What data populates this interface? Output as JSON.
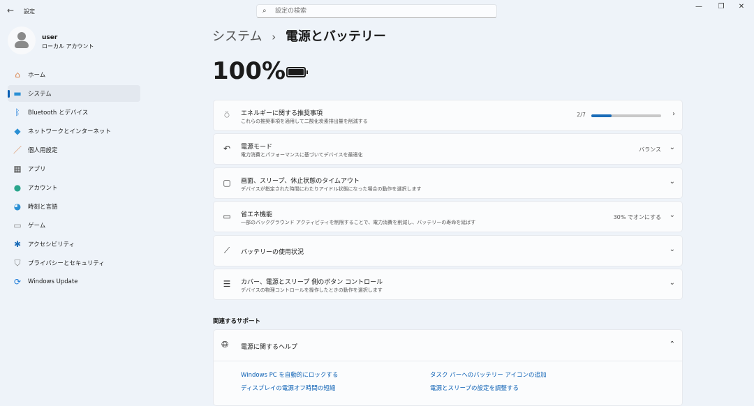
{
  "app": {
    "title": "設定",
    "back": "←"
  },
  "search": {
    "placeholder": "設定の検索"
  },
  "window": {
    "minimize": "—",
    "maximize": "❐",
    "close": "✕"
  },
  "user": {
    "name": "user",
    "type": "ローカル アカウント"
  },
  "sidebar": {
    "items": [
      {
        "label": "ホーム",
        "icon": "home-icon",
        "glyph": "⌂",
        "color": "#d9824a"
      },
      {
        "label": "システム",
        "icon": "system-icon",
        "glyph": "▬",
        "color": "#2a8fd4"
      },
      {
        "label": "Bluetooth とデバイス",
        "icon": "bluetooth-icon",
        "glyph": "ᛒ",
        "color": "#1a7ad8"
      },
      {
        "label": "ネットワークとインターネット",
        "icon": "wifi-icon",
        "glyph": "◆",
        "color": "#2a8fd4"
      },
      {
        "label": "個人用設定",
        "icon": "brush-icon",
        "glyph": "／",
        "color": "#d9824a"
      },
      {
        "label": "アプリ",
        "icon": "apps-icon",
        "glyph": "▦",
        "color": "#555"
      },
      {
        "label": "アカウント",
        "icon": "account-icon",
        "glyph": "●",
        "color": "#2aa58c"
      },
      {
        "label": "時刻と言語",
        "icon": "time-language-icon",
        "glyph": "◕",
        "color": "#2a8fd4"
      },
      {
        "label": "ゲーム",
        "icon": "gaming-icon",
        "glyph": "▭",
        "color": "#888"
      },
      {
        "label": "アクセシビリティ",
        "icon": "accessibility-icon",
        "glyph": "✱",
        "color": "#1a6cb8"
      },
      {
        "label": "プライバシーとセキュリティ",
        "icon": "shield-icon",
        "glyph": "⛉",
        "color": "#777"
      },
      {
        "label": "Windows Update",
        "icon": "update-icon",
        "glyph": "⟳",
        "color": "#1a7ad8"
      }
    ]
  },
  "breadcrumb": {
    "parent": "システム",
    "sep": "›",
    "current": "電源とバッテリー"
  },
  "battery": {
    "percent": "100%",
    "level": 1.0
  },
  "cards": [
    {
      "title": "エネルギーに関する推奨事項",
      "subtitle": "これらの推奨事項を適用して二酸化炭素排出量を削減する",
      "progress_label": "2/7",
      "progress": 0.2857,
      "chev": "›"
    },
    {
      "title": "電源モード",
      "subtitle": "電力消費とパフォーマンスに基づいてデバイスを最適化",
      "value": "バランス",
      "chev": "⌄"
    },
    {
      "title": "画面、スリープ、休止状態のタイムアウト",
      "subtitle": "デバイスが指定された時間にわたりアイドル状態になった場合の動作を選択します",
      "chev": "⌄"
    },
    {
      "title": "省エネ機能",
      "subtitle": "一部のバックグラウンド アクティビティを制限することで、電力消費を削減し、バッテリーの寿命を延ばす",
      "value": "30% でオンにする",
      "chev": "⌄"
    },
    {
      "title": "バッテリーの使用状況",
      "chev": "⌄"
    },
    {
      "title": "カバー、電源とスリープ 側のボタン コントロール",
      "subtitle": "デバイスの物理コントロールを操作したときの動作を選択します",
      "chev": "⌄"
    }
  ],
  "support": {
    "heading": "関連するサポート",
    "help_title": "電源に関するヘルプ",
    "chev": "⌃",
    "links": [
      "Windows PC を自動的にロックする",
      "ディスプレイの電源オフ時間の短縮",
      "タスク バーへのバッテリー アイコンの追加",
      "電源とスリープの設定を調整する"
    ]
  }
}
